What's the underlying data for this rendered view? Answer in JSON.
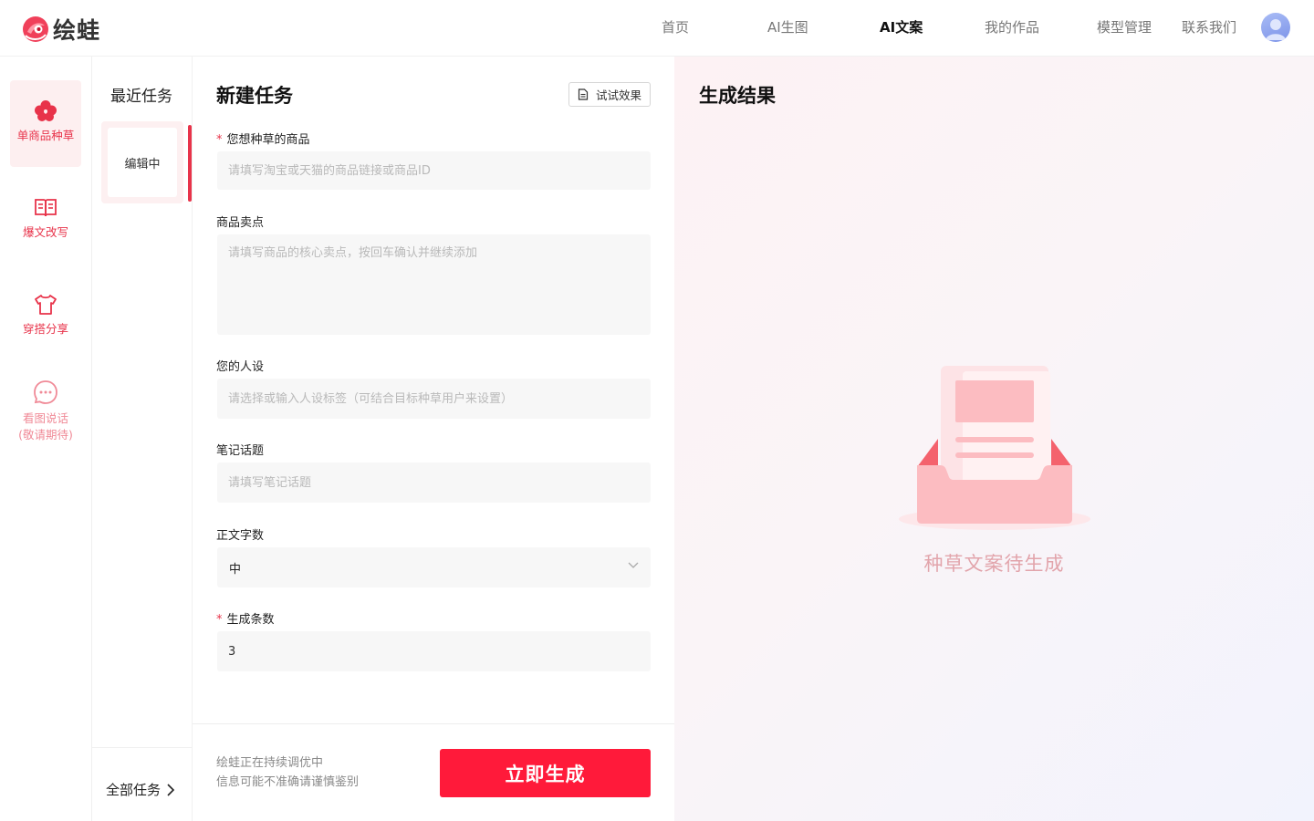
{
  "brand": {
    "name": "绘蛙",
    "accent": "#e8334a",
    "primary_button": "#ff1a3a"
  },
  "nav": {
    "items": [
      {
        "label": "首页",
        "active": false
      },
      {
        "label": "AI生图",
        "active": false
      },
      {
        "label": "AI文案",
        "active": true
      },
      {
        "label": "我的作品",
        "active": false
      },
      {
        "label": "模型管理",
        "active": false
      },
      {
        "label": "联系我们",
        "active": false
      }
    ],
    "avatar_icon": "user-avatar"
  },
  "sidebar": {
    "items": [
      {
        "label": "单商品种草",
        "icon": "clover-icon",
        "active": true
      },
      {
        "label": "爆文改写",
        "icon": "book-icon",
        "active": false
      },
      {
        "label": "穿搭分享",
        "icon": "shirt-icon",
        "active": false
      },
      {
        "label": "看图说话",
        "sub": "(敬请期待)",
        "icon": "chat-bubble-icon",
        "active": false
      }
    ]
  },
  "recent": {
    "title": "最近任务",
    "tasks": [
      {
        "label": "编辑中"
      }
    ],
    "all_tasks": "全部任务"
  },
  "form": {
    "title": "新建任务",
    "try_button": "试试效果",
    "fields": {
      "product": {
        "label": "您想种草的商品",
        "required": true,
        "placeholder": "请填写淘宝或天猫的商品链接或商品ID",
        "value": ""
      },
      "selling_points": {
        "label": "商品卖点",
        "required": false,
        "placeholder": "请填写商品的核心卖点，按回车确认并继续添加",
        "value": ""
      },
      "persona": {
        "label": "您的人设",
        "required": false,
        "placeholder": "请选择或输入人设标签（可结合目标种草用户来设置）",
        "value": ""
      },
      "topic": {
        "label": "笔记话题",
        "required": false,
        "placeholder": "请填写笔记话题",
        "value": ""
      },
      "word_count": {
        "label": "正文字数",
        "required": false,
        "value": "中"
      },
      "count": {
        "label": "生成条数",
        "required": true,
        "value": "3"
      }
    },
    "footnote": {
      "line1": "绘蛙正在持续调优中",
      "line2": "信息可能不准确请谨慎鉴别"
    },
    "generate_button": "立即生成"
  },
  "result": {
    "title": "生成结果",
    "empty_text": "种草文案待生成",
    "empty_icon": "inbox-document-icon"
  }
}
